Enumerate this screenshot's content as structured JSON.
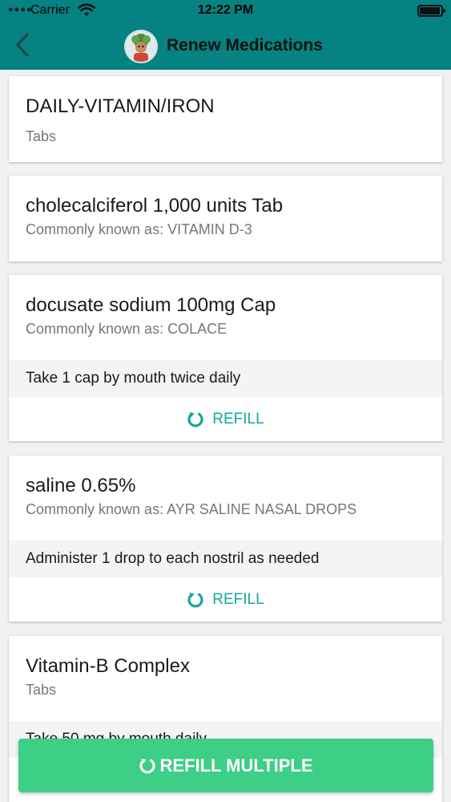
{
  "status_bar": {
    "carrier": "Carrier",
    "time": "12:22 PM"
  },
  "nav": {
    "title": "Renew Medications"
  },
  "medications": [
    {
      "name": "DAILY-VITAMIN/IRON",
      "subtitle": "Tabs"
    },
    {
      "name": "cholecalciferol 1,000 units Tab",
      "subtitle": "Commonly known as: VITAMIN D-3"
    },
    {
      "name": "docusate sodium 100mg Cap",
      "subtitle": "Commonly known as: COLACE",
      "instructions": "Take 1 cap by mouth twice daily",
      "action": "REFILL"
    },
    {
      "name": "saline 0.65%",
      "subtitle": "Commonly known as: AYR SALINE NASAL DROPS",
      "instructions": "Administer 1 drop to each nostril as needed",
      "action": "REFILL"
    },
    {
      "name": "Vitamin-B Complex",
      "subtitle": "Tabs",
      "instructions": "Take 50 mg by mouth daily"
    }
  ],
  "bottom_button": {
    "label": "REFILL MULTIPLE"
  },
  "colors": {
    "header": "#058281",
    "accent": "#13a79a",
    "primary_button": "#3ccf85"
  },
  "icons": {
    "back": "chevron-left-icon",
    "refill": "refresh-icon",
    "avatar": "profile-avatar"
  }
}
